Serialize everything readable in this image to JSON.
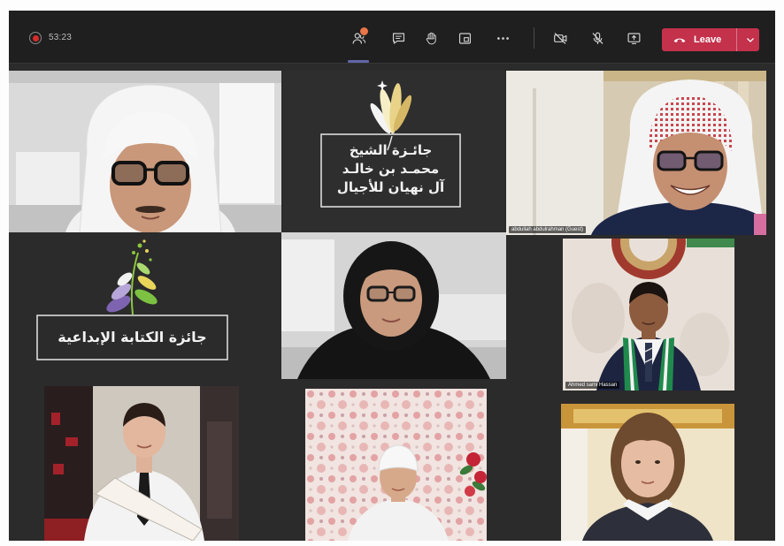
{
  "meeting": {
    "timer": "53:23",
    "recording_icon": "record-icon"
  },
  "toolbar": {
    "actions": [
      {
        "icon": "people-icon",
        "active": true,
        "badge": true
      },
      {
        "icon": "chat-icon"
      },
      {
        "icon": "raise-hand-icon"
      },
      {
        "icon": "breakout-rooms-icon"
      },
      {
        "icon": "more-icon"
      }
    ],
    "devices": [
      {
        "icon": "camera-off-icon"
      },
      {
        "icon": "mic-off-icon"
      },
      {
        "icon": "share-screen-icon"
      }
    ],
    "leave": {
      "label": "Leave",
      "icon": "hang-up-icon",
      "menu_icon": "chevron-down-icon"
    }
  },
  "video_grid": {
    "award_logo": {
      "icon": "feather-logo-icon",
      "lines": [
        "جائـزة الشيخ",
        "محمـد بن خالـد",
        "آل نهيان للأجيال"
      ]
    },
    "writing_award_logo": {
      "icon": "plant-logo-icon",
      "text": "جائزة الكتابة الإبداعية"
    },
    "name_labels": [
      "abdullah abdulrahman (Guest)",
      "Ahmed sami Hassan"
    ]
  },
  "colors": {
    "toolbar_bg": "#1f1f1f",
    "stage_bg": "#2b2b2b",
    "leave_button": "#c4314b",
    "active_underline": "#6264a7",
    "notification_badge": "#e97548",
    "recording": "#d92c2c"
  }
}
